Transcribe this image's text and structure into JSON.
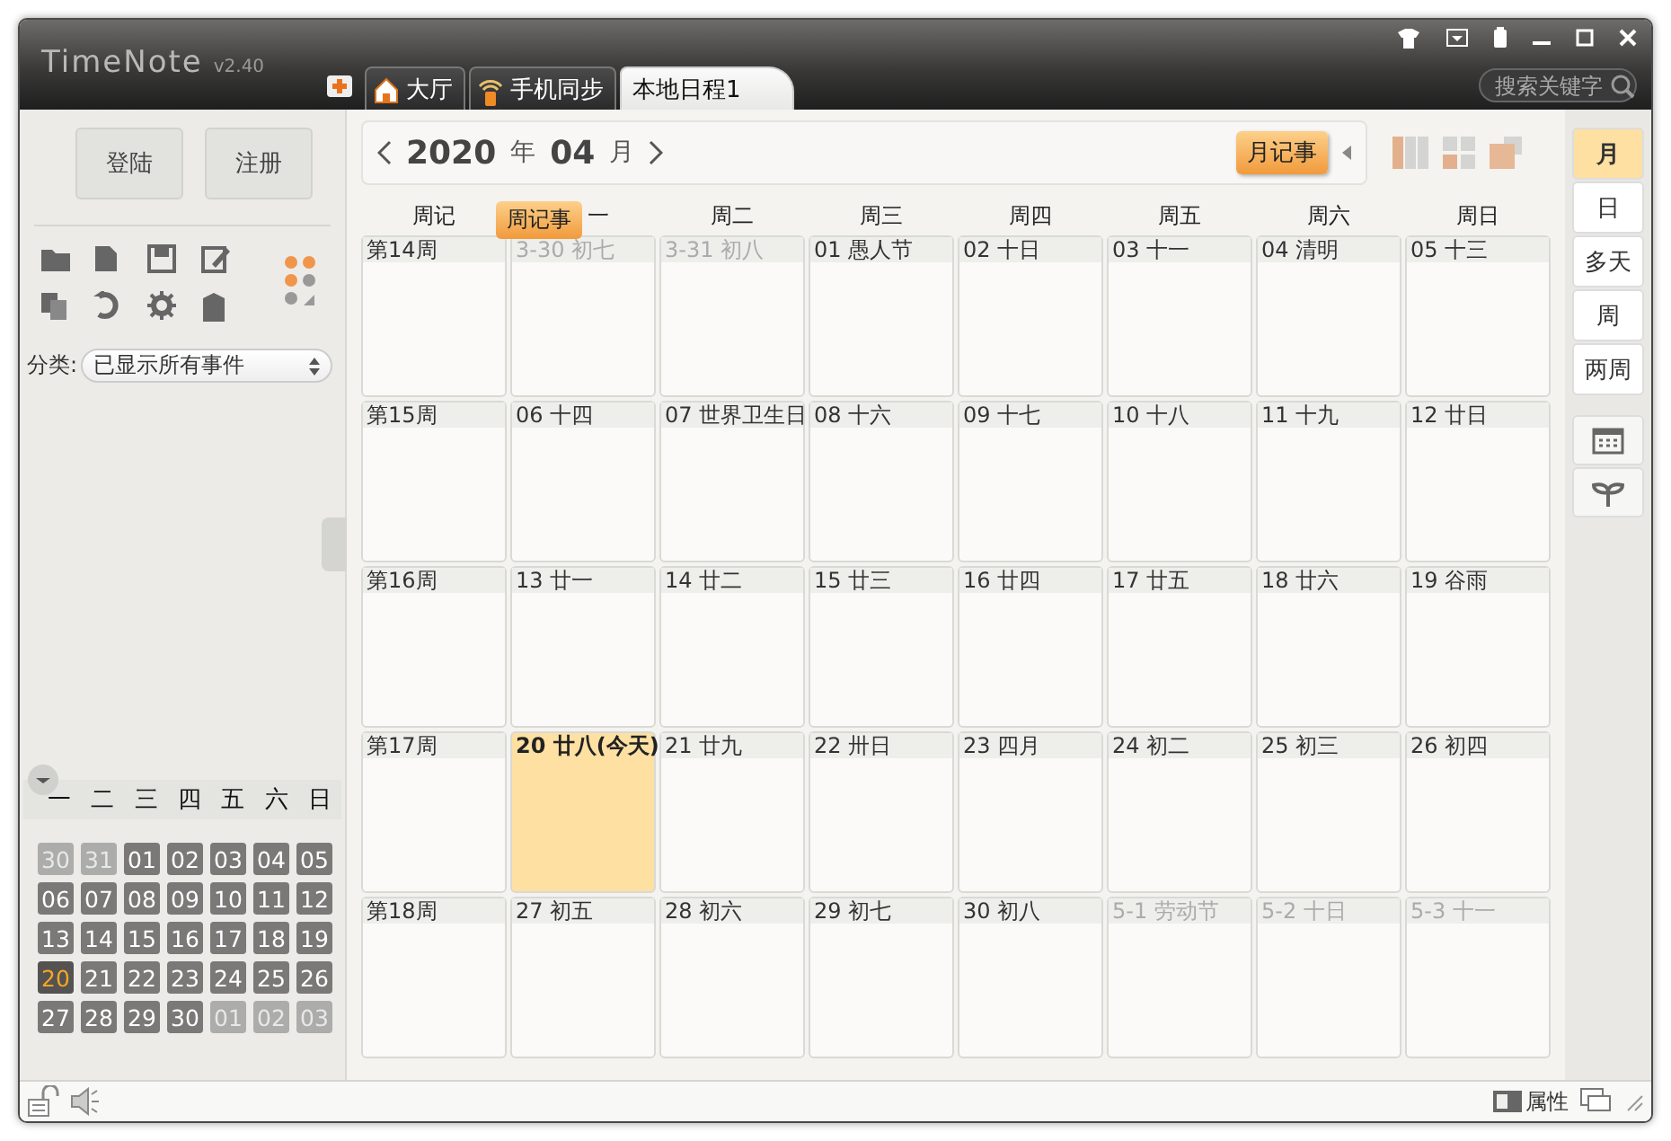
{
  "app": {
    "name": "TimeNote",
    "version": "v2.40"
  },
  "tabs": [
    {
      "label": "大厅",
      "selected": false
    },
    {
      "label": "手机同步",
      "selected": false
    },
    {
      "label": "本地日程1",
      "selected": true
    }
  ],
  "search": {
    "placeholder": "搜索关键字"
  },
  "account_buttons": [
    "登陆",
    "注册"
  ],
  "category": {
    "label": "分类:",
    "value": "已显示所有事件"
  },
  "mini_calendar": {
    "weekdays": [
      "一",
      "二",
      "三",
      "四",
      "五",
      "六",
      "日"
    ],
    "days": [
      {
        "text": "30",
        "muted": true,
        "today": false
      },
      {
        "text": "31",
        "muted": true,
        "today": false
      },
      {
        "text": "01",
        "muted": false,
        "today": false
      },
      {
        "text": "02",
        "muted": false,
        "today": false
      },
      {
        "text": "03",
        "muted": false,
        "today": false
      },
      {
        "text": "04",
        "muted": false,
        "today": false
      },
      {
        "text": "05",
        "muted": false,
        "today": false
      },
      {
        "text": "06",
        "muted": false,
        "today": false
      },
      {
        "text": "07",
        "muted": false,
        "today": false
      },
      {
        "text": "08",
        "muted": false,
        "today": false
      },
      {
        "text": "09",
        "muted": false,
        "today": false
      },
      {
        "text": "10",
        "muted": false,
        "today": false
      },
      {
        "text": "11",
        "muted": false,
        "today": false
      },
      {
        "text": "12",
        "muted": false,
        "today": false
      },
      {
        "text": "13",
        "muted": false,
        "today": false
      },
      {
        "text": "14",
        "muted": false,
        "today": false
      },
      {
        "text": "15",
        "muted": false,
        "today": false
      },
      {
        "text": "16",
        "muted": false,
        "today": false
      },
      {
        "text": "17",
        "muted": false,
        "today": false
      },
      {
        "text": "18",
        "muted": false,
        "today": false
      },
      {
        "text": "19",
        "muted": false,
        "today": false
      },
      {
        "text": "20",
        "muted": false,
        "today": true
      },
      {
        "text": "21",
        "muted": false,
        "today": false
      },
      {
        "text": "22",
        "muted": false,
        "today": false
      },
      {
        "text": "23",
        "muted": false,
        "today": false
      },
      {
        "text": "24",
        "muted": false,
        "today": false
      },
      {
        "text": "25",
        "muted": false,
        "today": false
      },
      {
        "text": "26",
        "muted": false,
        "today": false
      },
      {
        "text": "27",
        "muted": false,
        "today": false
      },
      {
        "text": "28",
        "muted": false,
        "today": false
      },
      {
        "text": "29",
        "muted": false,
        "today": false
      },
      {
        "text": "30",
        "muted": false,
        "today": false
      },
      {
        "text": "01",
        "muted": true,
        "today": false
      },
      {
        "text": "02",
        "muted": true,
        "today": false
      },
      {
        "text": "03",
        "muted": true,
        "today": false
      }
    ]
  },
  "toolbar": {
    "year": "2020",
    "year_unit": "年",
    "month": "04",
    "month_unit": "月",
    "month_note": "月记事"
  },
  "calendar": {
    "week_note_header": "周记",
    "week_note_badge": "周记事",
    "weekdays": [
      "一",
      "周二",
      "周三",
      "周四",
      "周五",
      "周六",
      "周日"
    ],
    "weeks": [
      {
        "label": "第14周",
        "days": [
          {
            "text": "3-30 初七",
            "muted": true,
            "today": false
          },
          {
            "text": "3-31 初八",
            "muted": true,
            "today": false
          },
          {
            "text": "01 愚人节",
            "muted": false,
            "today": false
          },
          {
            "text": "02 十日",
            "muted": false,
            "today": false
          },
          {
            "text": "03 十一",
            "muted": false,
            "today": false
          },
          {
            "text": "04 清明",
            "muted": false,
            "today": false
          },
          {
            "text": "05 十三",
            "muted": false,
            "today": false
          }
        ]
      },
      {
        "label": "第15周",
        "days": [
          {
            "text": "06 十四",
            "muted": false,
            "today": false
          },
          {
            "text": "07 世界卫生日",
            "muted": false,
            "today": false
          },
          {
            "text": "08 十六",
            "muted": false,
            "today": false
          },
          {
            "text": "09 十七",
            "muted": false,
            "today": false
          },
          {
            "text": "10 十八",
            "muted": false,
            "today": false
          },
          {
            "text": "11 十九",
            "muted": false,
            "today": false
          },
          {
            "text": "12 廿日",
            "muted": false,
            "today": false
          }
        ]
      },
      {
        "label": "第16周",
        "days": [
          {
            "text": "13 廿一",
            "muted": false,
            "today": false
          },
          {
            "text": "14 廿二",
            "muted": false,
            "today": false
          },
          {
            "text": "15 廿三",
            "muted": false,
            "today": false
          },
          {
            "text": "16 廿四",
            "muted": false,
            "today": false
          },
          {
            "text": "17 廿五",
            "muted": false,
            "today": false
          },
          {
            "text": "18 廿六",
            "muted": false,
            "today": false
          },
          {
            "text": "19 谷雨",
            "muted": false,
            "today": false
          }
        ]
      },
      {
        "label": "第17周",
        "days": [
          {
            "text": "20 廿八(今天)",
            "muted": false,
            "today": true
          },
          {
            "text": "21 廿九",
            "muted": false,
            "today": false
          },
          {
            "text": "22 卅日",
            "muted": false,
            "today": false
          },
          {
            "text": "23 四月",
            "muted": false,
            "today": false
          },
          {
            "text": "24 初二",
            "muted": false,
            "today": false
          },
          {
            "text": "25 初三",
            "muted": false,
            "today": false
          },
          {
            "text": "26 初四",
            "muted": false,
            "today": false
          }
        ]
      },
      {
        "label": "第18周",
        "days": [
          {
            "text": "27 初五",
            "muted": false,
            "today": false
          },
          {
            "text": "28 初六",
            "muted": false,
            "today": false
          },
          {
            "text": "29 初七",
            "muted": false,
            "today": false
          },
          {
            "text": "30 初八",
            "muted": false,
            "today": false
          },
          {
            "text": "5-1 劳动节",
            "muted": true,
            "today": false
          },
          {
            "text": "5-2 十日",
            "muted": true,
            "today": false
          },
          {
            "text": "5-3 十一",
            "muted": true,
            "today": false
          }
        ]
      }
    ]
  },
  "view_buttons": [
    {
      "label": "月",
      "selected": true
    },
    {
      "label": "日",
      "selected": false
    },
    {
      "label": "多天",
      "selected": false
    },
    {
      "label": "周",
      "selected": false
    },
    {
      "label": "两周",
      "selected": false
    }
  ],
  "status_bar": {
    "properties": "属性"
  }
}
